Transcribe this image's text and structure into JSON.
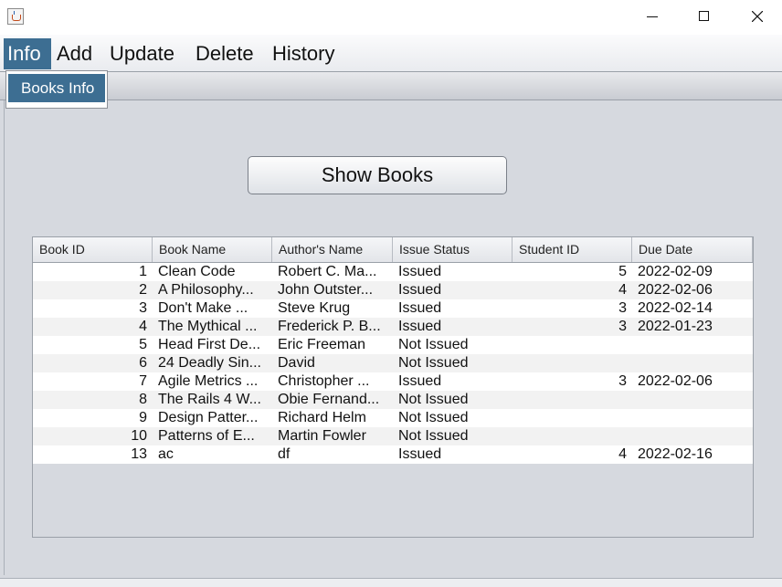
{
  "window": {
    "title": "",
    "icon": "java-cup-icon"
  },
  "menubar": {
    "items": [
      {
        "label": "Info",
        "active": true
      },
      {
        "label": "Add"
      },
      {
        "label": "Update"
      },
      {
        "label": "Delete"
      },
      {
        "label": "History"
      }
    ]
  },
  "dropdown": {
    "items": [
      {
        "label": "Books Info"
      }
    ]
  },
  "main": {
    "show_button_label": "Show Books"
  },
  "table": {
    "columns": [
      "Book ID",
      "Book Name",
      "Author's Name",
      "Issue Status",
      "Student ID",
      "Due Date"
    ],
    "rows": [
      [
        "1",
        " Clean Code",
        "Robert C. Ma...",
        "Issued",
        "5",
        "2022-02-09"
      ],
      [
        "2",
        " A Philosophy...",
        "John Outster...",
        "Issued",
        "4",
        "2022-02-06"
      ],
      [
        "3",
        "Don't Make ...",
        "Steve Krug",
        "Issued",
        "3",
        "2022-02-14"
      ],
      [
        "4",
        " The Mythical ...",
        "Frederick P. B...",
        "Issued",
        "3",
        "2022-01-23"
      ],
      [
        "5",
        "Head First De...",
        "Eric Freeman",
        "Not Issued",
        "",
        ""
      ],
      [
        "6",
        "24 Deadly Sin...",
        "David",
        "Not Issued",
        "",
        ""
      ],
      [
        "7",
        "Agile Metrics ...",
        "Christopher ...",
        "Issued",
        "3",
        "2022-02-06"
      ],
      [
        "8",
        "The Rails 4 W...",
        "Obie Fernand...",
        "Not Issued",
        "",
        ""
      ],
      [
        "9",
        "Design Patter...",
        "Richard Helm",
        "Not Issued",
        "",
        ""
      ],
      [
        "10",
        "Patterns of E...",
        " Martin Fowler",
        "Not Issued",
        "",
        ""
      ],
      [
        "13",
        "ac",
        "df",
        "Issued",
        "4",
        "2022-02-16"
      ]
    ]
  },
  "colors": {
    "menu_active": "#3d6e92",
    "panel_bg": "#d6d9df",
    "row_alt": "#f2f2f2"
  }
}
